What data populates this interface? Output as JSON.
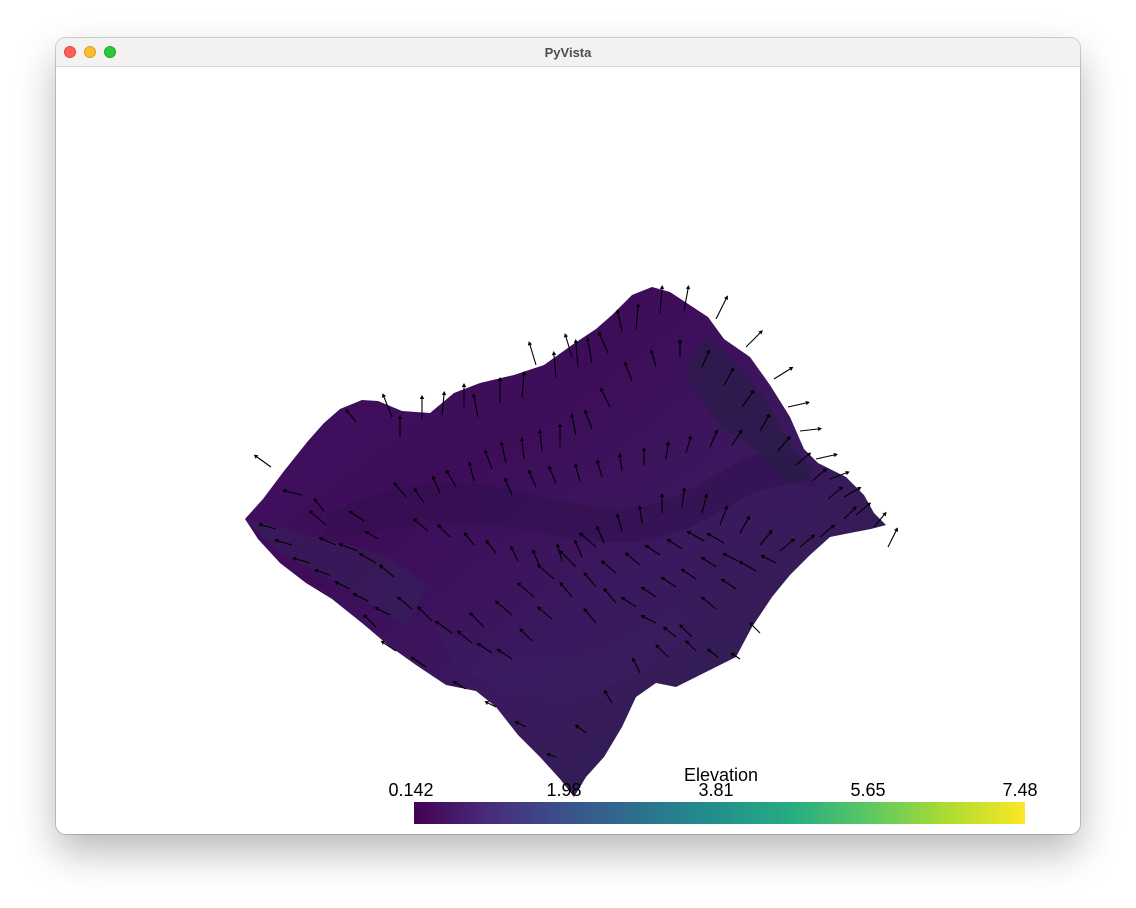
{
  "window": {
    "title": "PyVista"
  },
  "titlebar": {
    "buttons": [
      "close",
      "minimize",
      "zoom"
    ]
  },
  "scene": {
    "surface_color": "#3f0d5c",
    "surface_shade_dark": "#2b1445",
    "surface_shade_light": "#4a1a6e",
    "arrow_color": "#000000",
    "background": "#ffffff"
  },
  "colorbar": {
    "title": "Elevation",
    "labels": [
      "0.142",
      "1.98",
      "3.81",
      "5.65",
      "7.48"
    ],
    "colormap": "viridis",
    "stops": [
      "#440154",
      "#472d7b",
      "#3b528b",
      "#2c728e",
      "#21918c",
      "#28ae80",
      "#5ec962",
      "#addc30",
      "#fde725"
    ]
  }
}
